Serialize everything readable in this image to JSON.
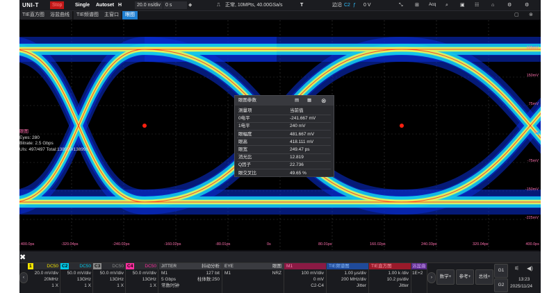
{
  "topbar": {
    "brand": "UNI-T",
    "run_state": "Stop",
    "single": "Single",
    "autoset": "Autoset",
    "horiz_mode": "H",
    "timebase": "20.0 ns/div",
    "delay": "0 s",
    "acquire": "正常, 10MPts, 40.00GSa/s",
    "trigger_mode": "T",
    "trigger_edge": "边沿",
    "trigger_source": "C2",
    "trigger_level": "0 V"
  },
  "tabs": [
    "TIE直方图",
    "浴盆曲线",
    "TIE频谱图",
    "主窗口",
    "眼图"
  ],
  "eye_info": {
    "title": "眼图",
    "eyes": "Eyes: 280",
    "bitrate": "Bitrate: 2.5 Gbps",
    "uis": "UIs: 497/497  Total:138999/138999"
  },
  "y_labels": [
    "225mV",
    "150mV",
    "75mV",
    "0V",
    "-75mV",
    "-150mV",
    "-225mV"
  ],
  "x_labels": [
    "-400.0ps",
    "-320.04ps",
    "-240.02ps",
    "-160.02ps",
    "-80.01ps",
    "0s",
    "80.01ps",
    "160.02ps",
    "240.03ps",
    "320.04ps",
    "400.0ps"
  ],
  "params": {
    "title": "眼图参数",
    "headers": [
      "测量项",
      "当前值"
    ],
    "rows": [
      [
        "0电平",
        "-241.667 mV"
      ],
      [
        "1电平",
        "240 mV"
      ],
      [
        "眼幅度",
        "481.667 mV"
      ],
      [
        "眼高",
        "418.111 mV"
      ],
      [
        "眼宽",
        "249.47 ps"
      ],
      [
        "消光比",
        "12.819"
      ],
      [
        "Q因子",
        "22.736"
      ],
      [
        "眼交叉比",
        "49.65 %"
      ]
    ]
  },
  "channels": [
    {
      "num": "1",
      "coupling": "DC50",
      "scale": "20.0 mV/div",
      "bw": "20MHz",
      "probe": "1 X",
      "color": "#f4e400"
    },
    {
      "num": "C2",
      "coupling": "DC50",
      "scale": "50.0 mV/div",
      "bw": "13GHz",
      "probe": "1 X",
      "color": "#00c8e8"
    },
    {
      "num": "C3",
      "coupling": "DC50",
      "scale": "50.0 mV/div",
      "bw": "13GHz",
      "probe": "1 X",
      "color": "#8a8a8a"
    },
    {
      "num": "C4",
      "coupling": "DC50",
      "scale": "50.0 mV/div",
      "bw": "13GHz",
      "probe": "1 X",
      "color": "#ff2fa0"
    }
  ],
  "jitter": {
    "title": "JITTER",
    "mode": "抖动分析",
    "src": "M1",
    "bits": "127 bit",
    "rate": "5 Gbps",
    "pattern": "柱体数:250",
    "clock": "常数时钟"
  },
  "eye_panel": {
    "title": "EYE",
    "mode": "眼图",
    "src": "M1",
    "code": "NRZ"
  },
  "math": {
    "title": "M1",
    "scale": "100 mV/div",
    "offset": "0 mV",
    "expr": "C2-C4"
  },
  "tie_spec": {
    "title": "TIE频谱图",
    "s1": "1.00 μs/div",
    "s2": "200 MHz/div",
    "s3": "Jitter"
  },
  "tie_hist": {
    "title": "TIE直方图",
    "s1": "1.00 k /div",
    "s2": "10.2 ps/div",
    "s3": "Jitter"
  },
  "extra": {
    "title": "浴盆曲",
    "s1": "1E+2"
  },
  "buttons": {
    "math": "数学+",
    "ref": "参考+",
    "bus": "总线+",
    "g1": "G1",
    "g2": "G2"
  },
  "clock": {
    "time": "13:23",
    "date": "2025/11/24"
  }
}
